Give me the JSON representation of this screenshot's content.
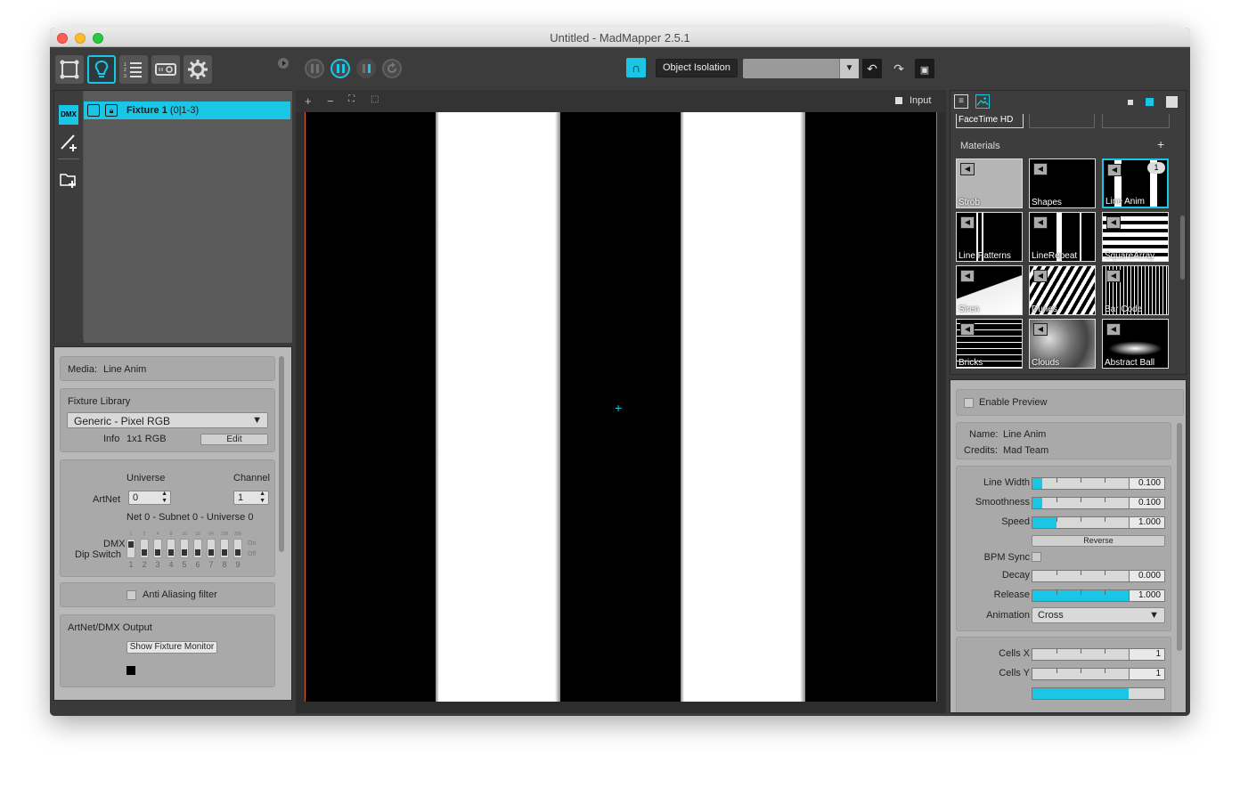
{
  "window": {
    "title": "Untitled - MadMapper 2.5.1"
  },
  "toolbar": {
    "object_isolation_label": "Object Isolation",
    "mode_icons": [
      "surface-mode-icon",
      "fixture-mode-icon",
      "list-mode-icon",
      "output-mode-icon",
      "settings-icon"
    ],
    "accent_color": "#19c6e6"
  },
  "fixture_list": {
    "items": [
      {
        "name": "Fixture 1",
        "address": "(0|1-3)"
      }
    ]
  },
  "fixture_props": {
    "media_label": "Media:",
    "media_value": "Line Anim",
    "library_title": "Fixture Library",
    "library_selected": "Generic - Pixel RGB",
    "info_label": "Info",
    "info_value": "1x1 RGB",
    "edit_label": "Edit",
    "universe_label": "Universe",
    "channel_label": "Channel",
    "artnet_label": "ArtNet",
    "universe_value": "0",
    "channel_value": "1",
    "net_text": "Net 0 - Subnet 0 - Universe 0",
    "dmx_label": "DMX",
    "dip_label": "Dip Switch",
    "dip_top_labels": [
      "1",
      "2",
      "4",
      "8",
      "16",
      "32",
      "64",
      "128",
      "256"
    ],
    "dip_numbers": [
      "1",
      "2",
      "3",
      "4",
      "5",
      "6",
      "7",
      "8",
      "9"
    ],
    "dip_on": "On",
    "dip_off": "Off",
    "anti_alias_label": "Anti Aliasing filter",
    "output_title": "ArtNet/DMX Output",
    "show_monitor_label": "Show Fixture Monitor"
  },
  "viewport": {
    "input_label": "Input",
    "tools": [
      "+",
      "−",
      "⛶",
      "⬚"
    ]
  },
  "media_browser": {
    "camera_label": "FaceTime HD",
    "materials_title": "Materials",
    "add_label": "+",
    "materials": [
      {
        "name": "Strob"
      },
      {
        "name": "Shapes"
      },
      {
        "name": "Line Anim",
        "badge": "1"
      },
      {
        "name": "Line Patterns"
      },
      {
        "name": "LineRepeat"
      },
      {
        "name": "SquareArray"
      },
      {
        "name": "Siren"
      },
      {
        "name": "Dunes"
      },
      {
        "name": "Bar Code"
      },
      {
        "name": "Bricks"
      },
      {
        "name": "Clouds"
      },
      {
        "name": "Abstract Ball"
      }
    ]
  },
  "params": {
    "enable_preview_label": "Enable Preview",
    "name_label": "Name:",
    "name_value": "Line Anim",
    "credits_label": "Credits:",
    "credits_value": "Mad Team",
    "line_width_label": "Line Width",
    "line_width_value": "0.100",
    "line_width_fraction": 0.1,
    "smoothness_label": "Smoothness",
    "smoothness_value": "0.100",
    "smoothness_fraction": 0.1,
    "speed_label": "Speed",
    "speed_value": "1.000",
    "speed_fraction": 0.25,
    "reverse_label": "Reverse",
    "bpm_sync_label": "BPM Sync",
    "decay_label": "Decay",
    "decay_value": "0.000",
    "decay_fraction": 0,
    "release_label": "Release",
    "release_value": "1.000",
    "release_fraction": 1,
    "animation_label": "Animation",
    "animation_value": "Cross",
    "cells_x_label": "Cells X",
    "cells_x_value": "1",
    "cells_y_label": "Cells Y",
    "cells_y_value": "1"
  }
}
